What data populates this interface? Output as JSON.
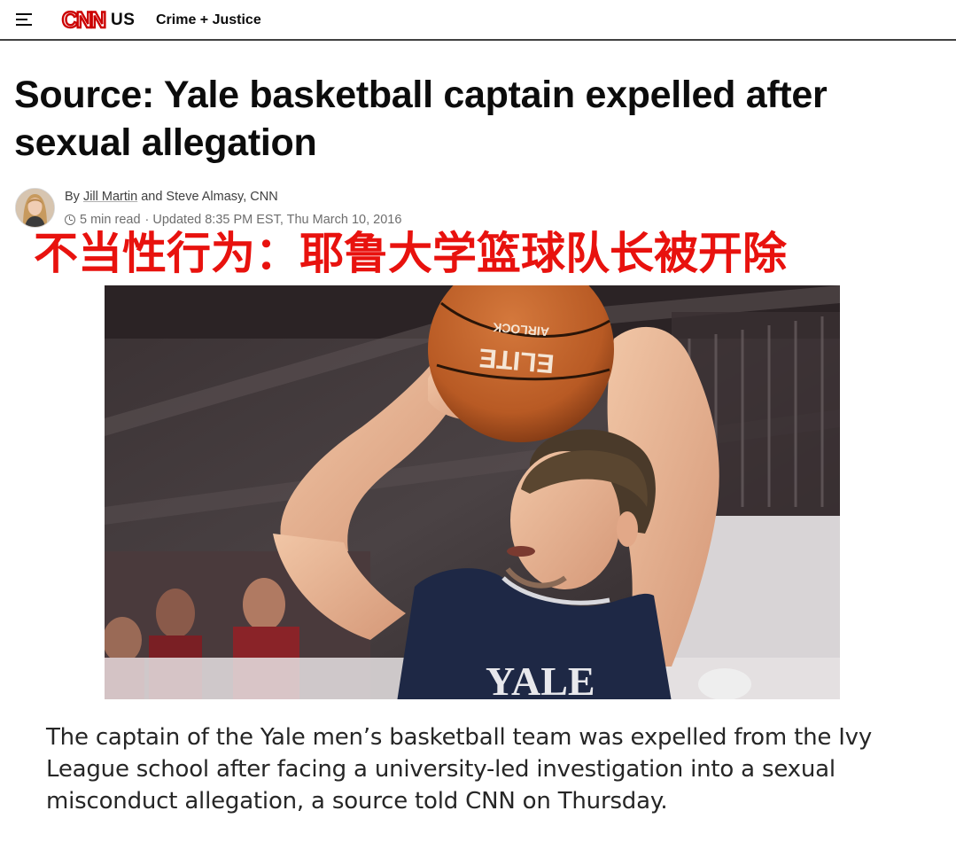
{
  "header": {
    "menu_icon": "hamburger-menu-icon",
    "logo_text": "CNN",
    "edition": "US",
    "section": "Crime + Justice",
    "brand_color": "#cc0000"
  },
  "article": {
    "headline": "Source: Yale basketball captain expelled after sexual allegation",
    "byline_prefix": "By ",
    "author_1": "Jill Martin",
    "byline_joiner": " and Steve Almasy, CNN",
    "read_time": "5 min read",
    "updated": "· Updated 8:35 PM EST, Thu March 10, 2016",
    "overlay_caption": "不当性行为：耶鲁大学篮球队长被开除",
    "overlay_color": "#e8120e",
    "photo_jersey_text": "YALE",
    "ball_brand": "ELITE",
    "ball_model": "AIRLOCK",
    "paragraph": "The captain of the Yale men’s basketball team was expelled from the Ivy League school after facing a university-led investigation into a sexual misconduct allegation, a source told CNN on Thursday."
  }
}
